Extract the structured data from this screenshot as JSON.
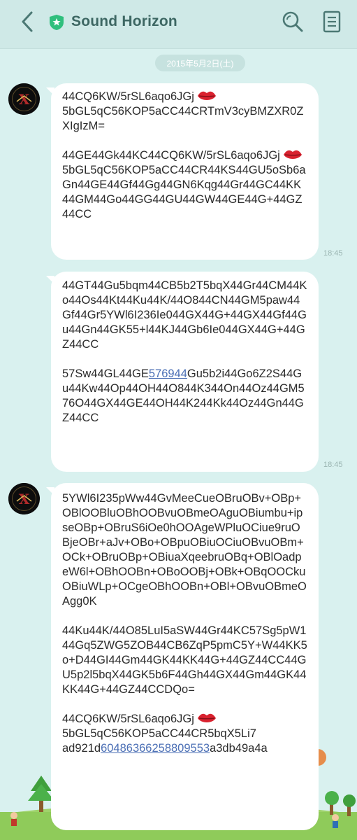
{
  "header": {
    "title": "Sound Horizon"
  },
  "date_label": "2015年5月2日(土)",
  "messages": [
    {
      "part1": "44CQ6KW/5rSL6aqo6JGj",
      "part2": "5bGL5qC56KOP5aCC44CRTmV3cyBMZXR0ZXIgIzM=\n\n44GE44Gk44KC44CQ6KW/5rSL6aqo6JGj",
      "part3": "5bGL5qC56KOP5aCC44CR44KS44GU5oSb6aGn44GE44Gf44Gg44GN6Kqg44Gr44GC44KK44GM44Go44GG44GU44GW44GE44G+44GZ44CC",
      "time": "18:45"
    },
    {
      "part1": "44GT44Gu5bqm44CB5b2T5bqX44Gr44CM44Ko44Os44Kt44Ku44K/44O844CN44GM5paw44Gf44Gr5YWl6I236Ie044GX44G+44GX44Gf44Gu44Gn44GK55+l44KJ44Gb6Ie044GX44G+44GZ44CC\n\n57Sw44GL44GE",
      "link": "576944",
      "part2": "Gu5b2i44Go6Z2S44Gu44Kw44Op44OH44O844K344On44Oz44GM576O44GX44GE44OH44K244Kk44Oz44Gn44GZ44CC",
      "time": "18:45"
    },
    {
      "part1": "5YWl6I235pWw44GvMeeCueOBruOBv+OBp+OBlOOBluOBhOOBvuOBmeOAguOBiumbu+ipseOBp+OBruS6iOe0hOOAgeWPluOCiue9ruOBjeOBr+aJv+OBo+OBpuOBiuOCiuOBvuOBm+OCk+OBruOBp+OBiuaXqeebruOBq+OBlOadpeW6l+OBhOOBn+OBoOOBj+OBk+OBqOOCkuOBiuWLp+OCgeOBhOOBn+OBl+OBvuOBmeOAgg0K\n\n44Ku44K/44O85LuI5aSW44Gr44KC57Sg5pW144Gq5ZWG5ZOB44CB6ZqP5pmC5Y+W44KK5o+D44GI44Gm44GK44KK44G+44GZ44CC44GU5p2l5bqX44GK5b6F44Gh44GX44Gm44GK44KK44G+44GZ44CCDQo=\n\n44CQ6KW/5rSL6aqo6JGj",
      "part2": "5bGL5qC56KOP5aCC44CR5bqX5Li7\nad921d",
      "link": "60486366258809553",
      "part3": "a3db49a4a"
    }
  ],
  "colors": {
    "background": "#d9f1ef",
    "header": "#cfe9e7",
    "accent": "#3d6763",
    "link": "#4b6fb5",
    "bubble": "#ffffff"
  },
  "icons": [
    "back-arrow-icon",
    "shield-star-icon",
    "search-icon",
    "menu-list-icon",
    "lips-emoji-icon"
  ]
}
